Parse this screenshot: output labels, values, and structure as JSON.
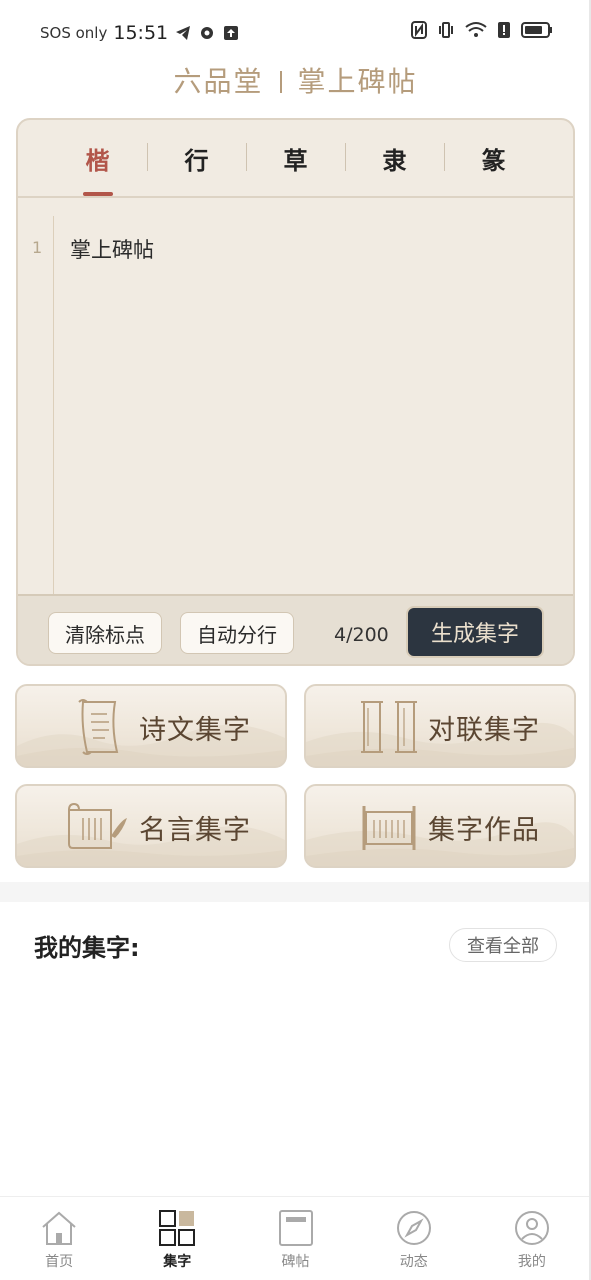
{
  "status_bar": {
    "carrier": "SOS only",
    "time": "15:51"
  },
  "logo": {
    "left": "六品堂",
    "right": "掌上碑帖"
  },
  "tabs": [
    {
      "label": "楷",
      "active": true
    },
    {
      "label": "行",
      "active": false
    },
    {
      "label": "草",
      "active": false
    },
    {
      "label": "隶",
      "active": false
    },
    {
      "label": "篆",
      "active": false
    }
  ],
  "editor": {
    "line_number": "1",
    "text": "掌上碑帖"
  },
  "toolbar": {
    "clear_label": "清除标点",
    "split_label": "自动分行",
    "counter": "4/200",
    "generate_label": "生成集字"
  },
  "features": [
    {
      "label": "诗文集字",
      "icon": "scroll-icon"
    },
    {
      "label": "对联集字",
      "icon": "couplet-icon"
    },
    {
      "label": "名言集字",
      "icon": "quote-scroll-icon"
    },
    {
      "label": "集字作品",
      "icon": "artwork-scroll-icon"
    }
  ],
  "my_section": {
    "title": "我的集字:",
    "view_all": "查看全部"
  },
  "nav": [
    {
      "label": "首页",
      "icon": "home-icon",
      "active": false
    },
    {
      "label": "集字",
      "icon": "grid-icon",
      "active": true
    },
    {
      "label": "碑帖",
      "icon": "book-icon",
      "active": false
    },
    {
      "label": "动态",
      "icon": "compass-icon",
      "active": false
    },
    {
      "label": "我的",
      "icon": "profile-icon",
      "active": false
    }
  ],
  "colors": {
    "accent": "#b2564a",
    "card_bg": "#f1ebe2",
    "dark_button": "#2c3540",
    "gold": "#b59c7c"
  }
}
